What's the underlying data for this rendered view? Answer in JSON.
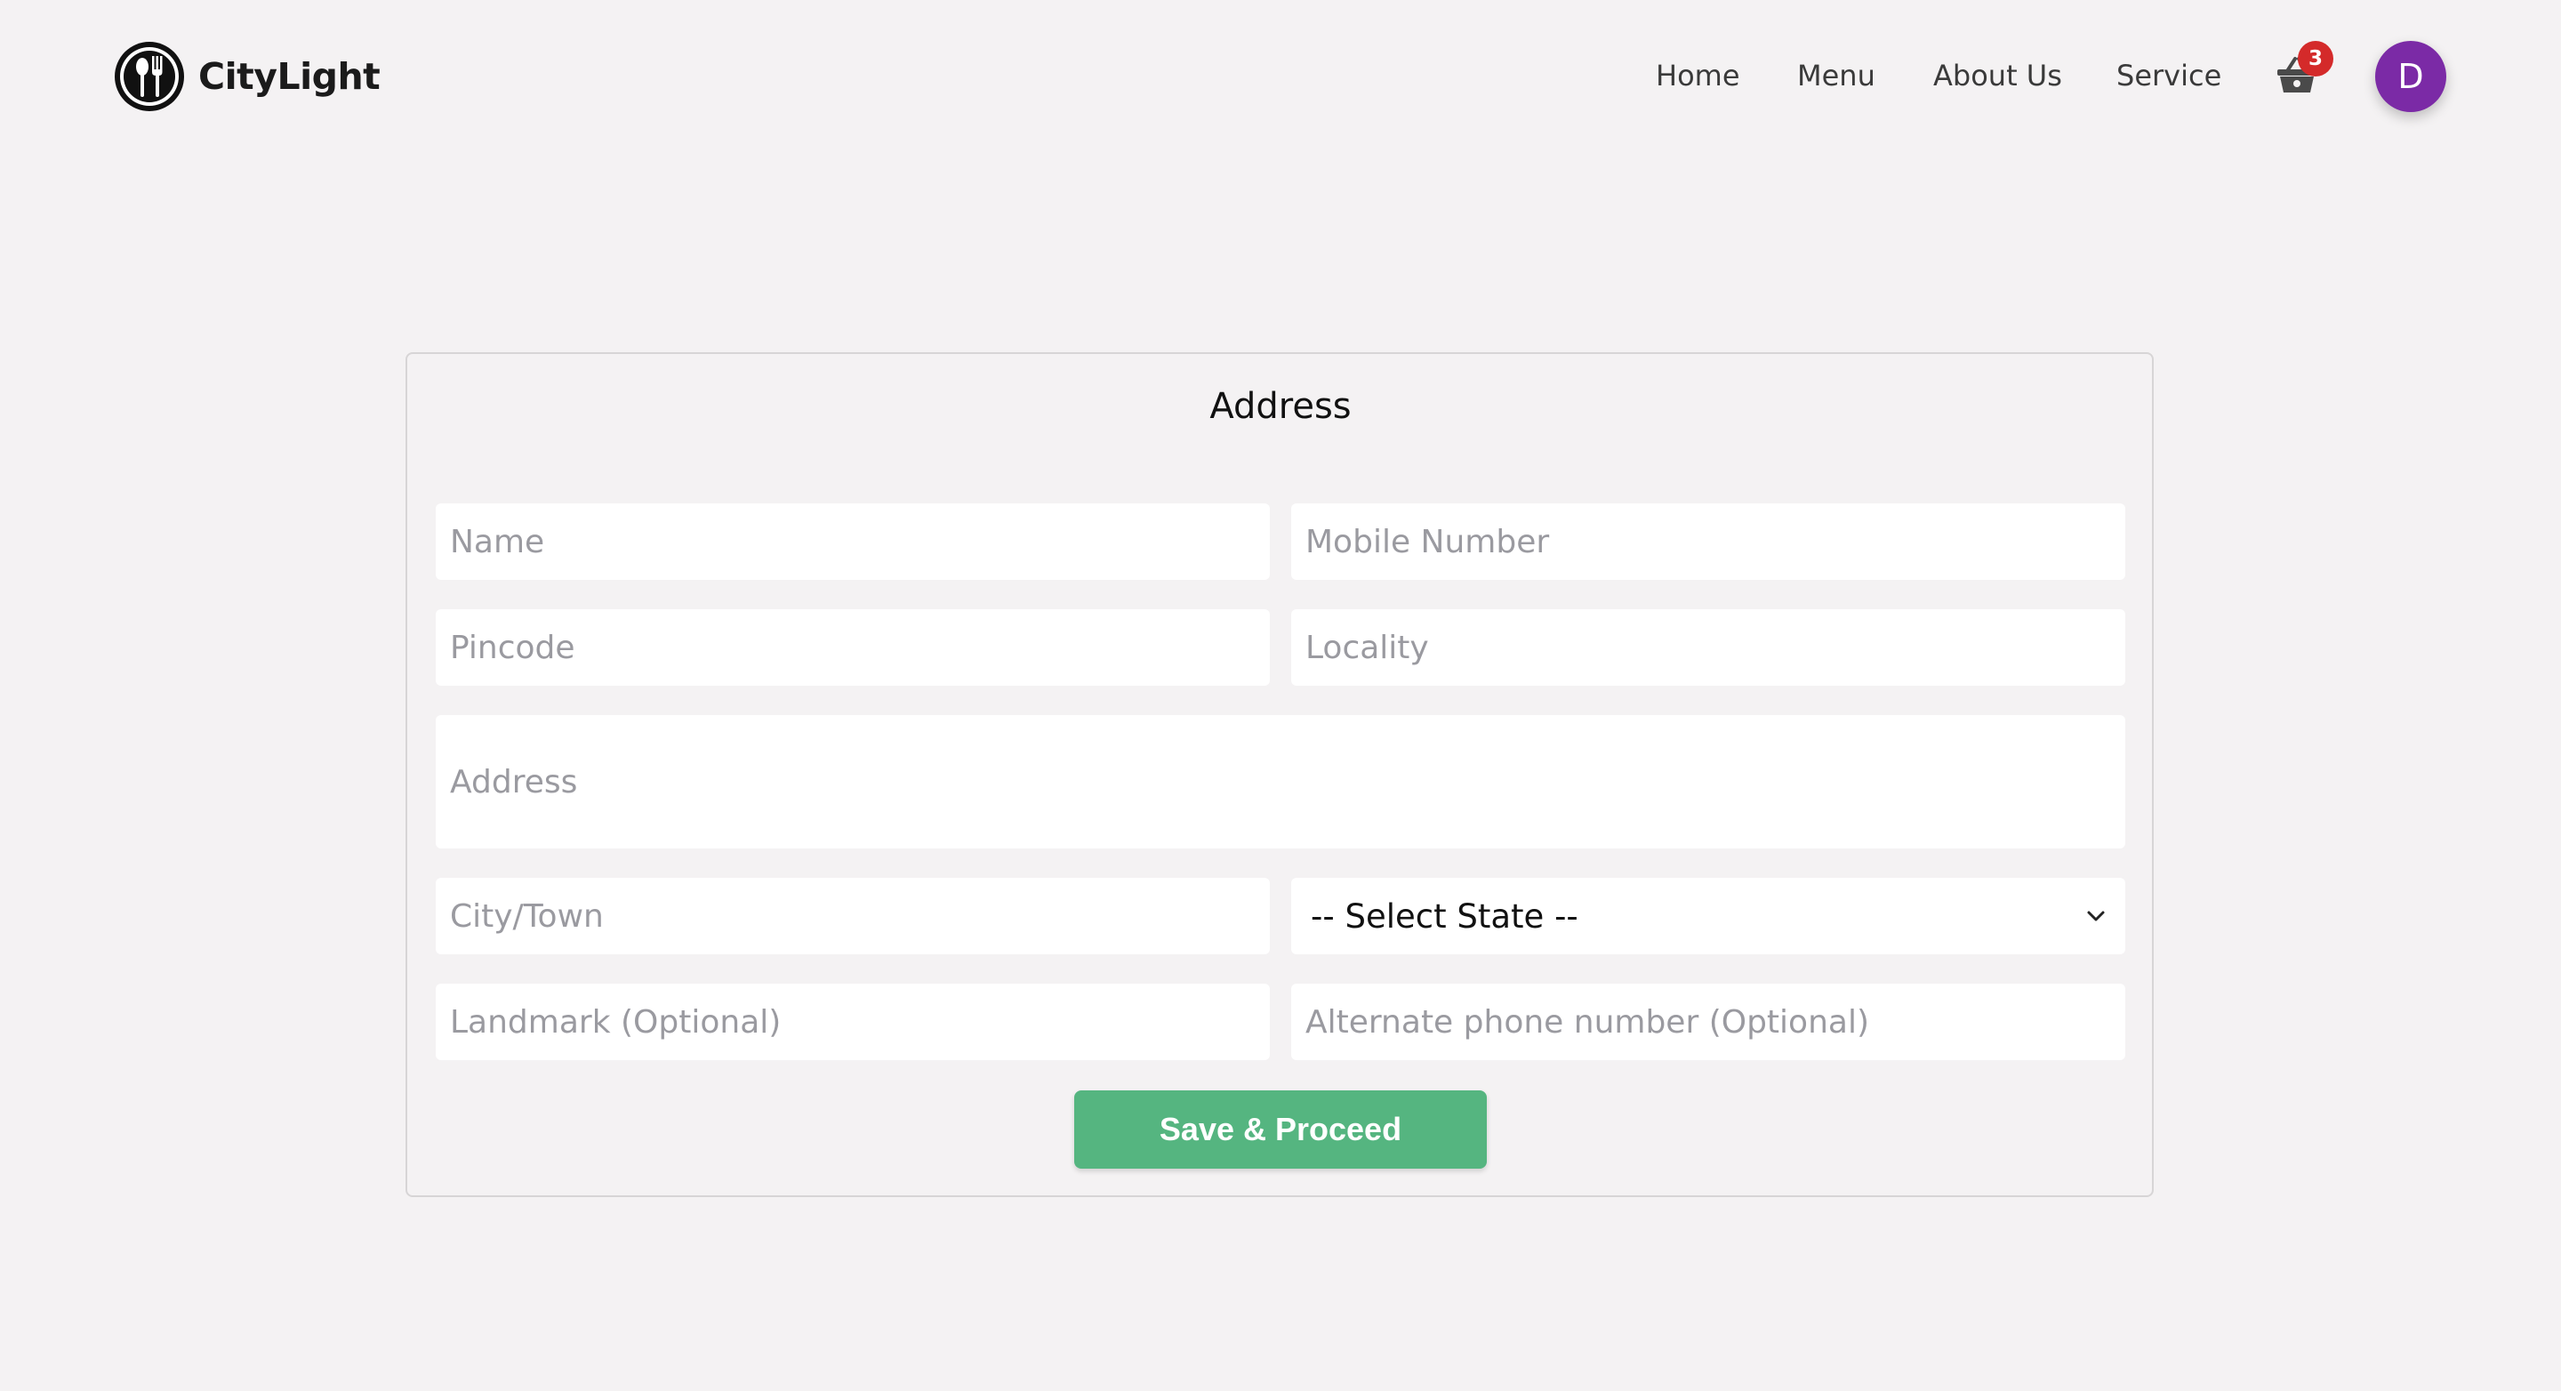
{
  "brand": {
    "name": "CityLight"
  },
  "nav": {
    "items": [
      {
        "label": "Home"
      },
      {
        "label": "Menu"
      },
      {
        "label": "About Us"
      },
      {
        "label": "Service"
      }
    ],
    "cart_count": "3",
    "avatar_initial": "D"
  },
  "form": {
    "title": "Address",
    "fields": {
      "name": {
        "placeholder": "Name",
        "value": ""
      },
      "mobile": {
        "placeholder": "Mobile Number",
        "value": ""
      },
      "pincode": {
        "placeholder": "Pincode",
        "value": ""
      },
      "locality": {
        "placeholder": "Locality",
        "value": ""
      },
      "address": {
        "placeholder": "Address",
        "value": ""
      },
      "city": {
        "placeholder": "City/Town",
        "value": ""
      },
      "landmark": {
        "placeholder": "Landmark (Optional)",
        "value": ""
      },
      "alt_phone": {
        "placeholder": "Alternate phone number (Optional)",
        "value": ""
      }
    },
    "state_select": {
      "selected": "-- Select State --"
    },
    "submit_label": "Save & Proceed"
  },
  "colors": {
    "background": "#f4f2f3",
    "accent_green": "#55b580",
    "avatar_purple": "#7b2aa6",
    "badge_red": "#d42a2a"
  },
  "icons": {
    "logo": "fork-spoon-logo-icon",
    "cart": "basket-icon",
    "select": "chevron-down-icon"
  }
}
